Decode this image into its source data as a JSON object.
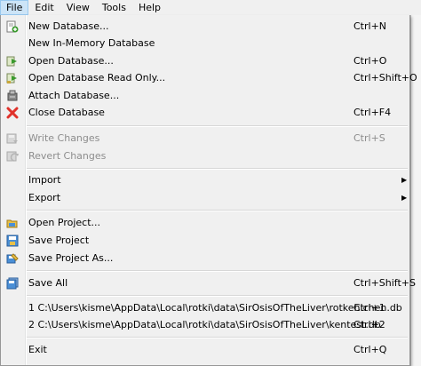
{
  "menubar": {
    "items": [
      {
        "label": "File",
        "active": true
      },
      {
        "label": "Edit"
      },
      {
        "label": "View"
      },
      {
        "label": "Tools"
      },
      {
        "label": "Help"
      }
    ]
  },
  "file_menu": {
    "items": [
      {
        "label": "New Database...",
        "shortcut": "Ctrl+N",
        "icon": "new-database-icon"
      },
      {
        "label": "New In-Memory Database",
        "shortcut": ""
      },
      {
        "label": "Open Database...",
        "shortcut": "Ctrl+O",
        "icon": "open-database-icon"
      },
      {
        "label": "Open Database Read Only...",
        "shortcut": "Ctrl+Shift+O",
        "icon": "open-database-readonly-icon"
      },
      {
        "label": "Attach Database...",
        "shortcut": "",
        "icon": "attach-database-icon"
      },
      {
        "label": "Close Database",
        "shortcut": "Ctrl+F4",
        "icon": "close-icon"
      },
      {
        "label": "Write Changes",
        "shortcut": "Ctrl+S",
        "icon": "write-changes-icon",
        "disabled": true
      },
      {
        "label": "Revert Changes",
        "shortcut": "",
        "icon": "revert-changes-icon",
        "disabled": true
      },
      {
        "label": "Import",
        "submenu": true
      },
      {
        "label": "Export",
        "submenu": true
      },
      {
        "label": "Open Project...",
        "shortcut": "",
        "icon": "open-project-icon"
      },
      {
        "label": "Save Project",
        "shortcut": "",
        "icon": "save-project-icon"
      },
      {
        "label": "Save Project As...",
        "shortcut": "",
        "icon": "save-project-as-icon"
      },
      {
        "label": "Save All",
        "shortcut": "Ctrl+Shift+S",
        "icon": "save-all-icon"
      },
      {
        "label": "1 C:\\Users\\kisme\\AppData\\Local\\rotki\\data\\SirOsisOfTheLiver\\rotkehlchen.db",
        "shortcut": "Ctrl+1"
      },
      {
        "label": "2 C:\\Users\\kisme\\AppData\\Local\\rotki\\data\\SirOsisOfTheLiver\\kentest.db",
        "shortcut": "Ctrl+2"
      },
      {
        "label": "Exit",
        "shortcut": "Ctrl+Q"
      }
    ]
  },
  "colors": {
    "menu_bg": "#f0f0f0",
    "active_tab": "#cce4f7",
    "disabled_text": "#8d8d8d",
    "green_arrow": "#3a9a2e",
    "close_red": "#e0322b"
  }
}
